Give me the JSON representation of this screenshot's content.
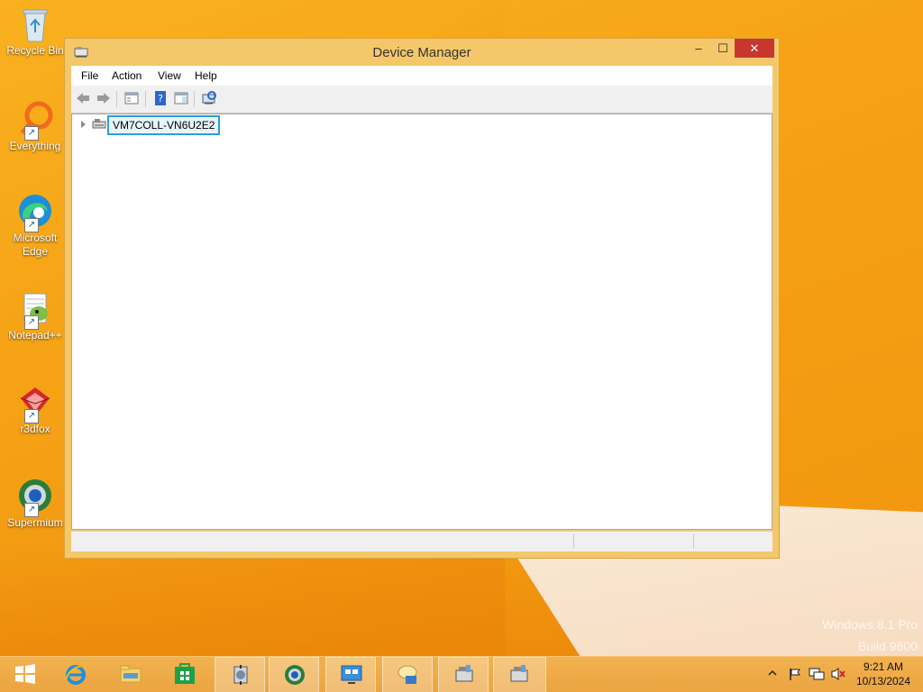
{
  "desktop": {
    "icons": [
      {
        "label": "Recycle Bin"
      },
      {
        "label": "Everything"
      },
      {
        "label": "Microsoft Edge"
      },
      {
        "label": "Notepad++"
      },
      {
        "label": "r3dfox"
      },
      {
        "label": "Supermium"
      }
    ],
    "watermark_line1": "Windows 8.1 Pro",
    "watermark_line2": "Build 9600"
  },
  "window": {
    "title": "Device Manager",
    "controls": {
      "minimize": "–",
      "maximize": "☐",
      "close": "✕"
    },
    "menu": [
      "File",
      "Action",
      "View",
      "Help"
    ],
    "toolbar_icons": [
      "back-arrow-icon",
      "forward-arrow-icon",
      "properties-pane-icon",
      "help-icon",
      "action-pane-icon",
      "scan-hardware-icon"
    ],
    "tree": {
      "root_label": "VM7COLL-VN6U2E2",
      "expanded": false
    }
  },
  "taskbar": {
    "apps": [
      "start",
      "internet-explorer",
      "file-explorer",
      "store",
      "settings-tool",
      "supermium",
      "remote-desktop",
      "messaging",
      "device-manager-1",
      "device-manager-2"
    ],
    "clock_time": "9:21 AM",
    "clock_date": "10/13/2024"
  },
  "colors": {
    "accent": "#f6a316",
    "selection_border": "#2aa0d8",
    "close_button": "#c7372f"
  }
}
